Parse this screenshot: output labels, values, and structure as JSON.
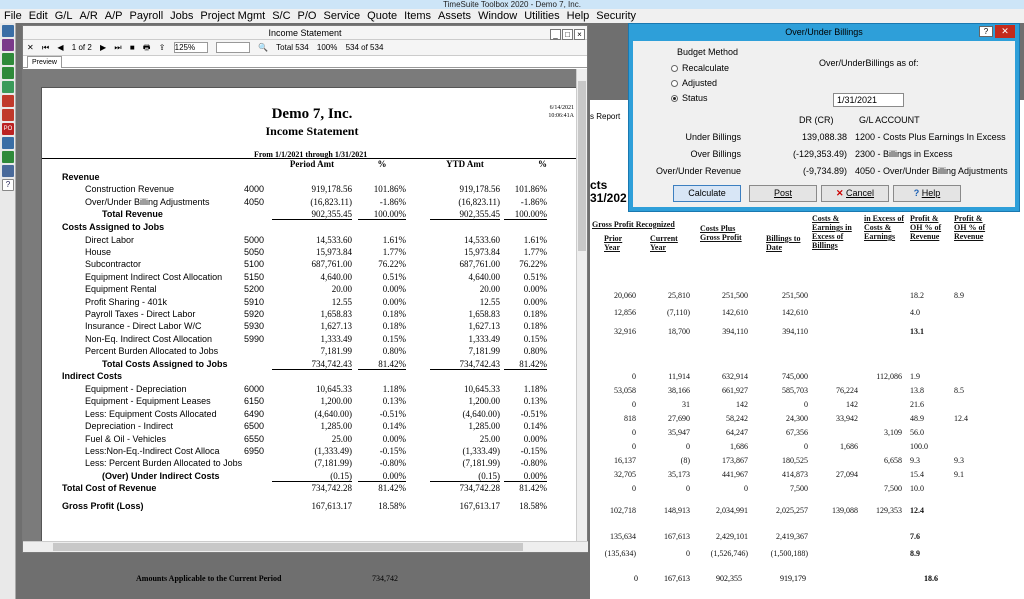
{
  "app": {
    "title": "TimeSuite Toolbox 2020 - Demo 7, Inc."
  },
  "menu": [
    "File",
    "Edit",
    "G/L",
    "A/R",
    "A/P",
    "Payroll",
    "Jobs",
    "Project Mgmt",
    "S/C",
    "P/O",
    "Service",
    "Quote",
    "Items",
    "Assets",
    "Window",
    "Utilities",
    "Help",
    "Security"
  ],
  "income_window": {
    "title": "Income Statement",
    "page": "1 of 2",
    "zoom": "125%",
    "total_label": "Total 534",
    "percent": "100%",
    "count": "534 of 534",
    "tab": "Preview"
  },
  "report": {
    "company": "Demo 7, Inc.",
    "title": "Income Statement",
    "date": "6/14/2021",
    "time": "10:06:41A",
    "range": "From 1/1/2021 through 1/31/2021",
    "headers": {
      "period_amt": "Period Amt",
      "period_pct": "%",
      "ytd_amt": "YTD Amt",
      "ytd_pct": "%"
    },
    "rows": [
      {
        "type": "sec",
        "label": "Revenue"
      },
      {
        "label": "Construction Revenue",
        "code": "4000",
        "pa": "919,178.56",
        "pp": "101.86%",
        "ya": "919,178.56",
        "yp": "101.86%"
      },
      {
        "label": "Over/Under Billing Adjustments",
        "code": "4050",
        "pa": "(16,823.11)",
        "pp": "-1.86%",
        "ya": "(16,823.11)",
        "yp": "-1.86%"
      },
      {
        "type": "tot",
        "label": "Total Revenue",
        "pa": "902,355.45",
        "pp": "100.00%",
        "ya": "902,355.45",
        "yp": "100.00%"
      },
      {
        "type": "sec",
        "label": "Costs Assigned to Jobs"
      },
      {
        "label": "Direct Labor",
        "code": "5000",
        "pa": "14,533.60",
        "pp": "1.61%",
        "ya": "14,533.60",
        "yp": "1.61%"
      },
      {
        "label": "House",
        "code": "5050",
        "pa": "15,973.84",
        "pp": "1.77%",
        "ya": "15,973.84",
        "yp": "1.77%"
      },
      {
        "label": "Subcontractor",
        "code": "5100",
        "pa": "687,761.00",
        "pp": "76.22%",
        "ya": "687,761.00",
        "yp": "76.22%"
      },
      {
        "label": "Equipment Indirect Cost Allocation",
        "code": "5150",
        "pa": "4,640.00",
        "pp": "0.51%",
        "ya": "4,640.00",
        "yp": "0.51%"
      },
      {
        "label": "Equipment Rental",
        "code": "5200",
        "pa": "20.00",
        "pp": "0.00%",
        "ya": "20.00",
        "yp": "0.00%"
      },
      {
        "label": "Profit Sharing - 401k",
        "code": "5910",
        "pa": "12.55",
        "pp": "0.00%",
        "ya": "12.55",
        "yp": "0.00%"
      },
      {
        "label": "Payroll Taxes - Direct Labor",
        "code": "5920",
        "pa": "1,658.83",
        "pp": "0.18%",
        "ya": "1,658.83",
        "yp": "0.18%"
      },
      {
        "label": "Insurance - Direct Labor W/C",
        "code": "5930",
        "pa": "1,627.13",
        "pp": "0.18%",
        "ya": "1,627.13",
        "yp": "0.18%"
      },
      {
        "label": "Non-Eq. Indirect Cost Allocation",
        "code": "5990",
        "pa": "1,333.49",
        "pp": "0.15%",
        "ya": "1,333.49",
        "yp": "0.15%"
      },
      {
        "label": "Percent Burden Allocated to Jobs",
        "code": "",
        "pa": "7,181.99",
        "pp": "0.80%",
        "ya": "7,181.99",
        "yp": "0.80%"
      },
      {
        "type": "tot",
        "label": "Total Costs Assigned to Jobs",
        "pa": "734,742.43",
        "pp": "81.42%",
        "ya": "734,742.43",
        "yp": "81.42%"
      },
      {
        "type": "sec",
        "label": "Indirect Costs"
      },
      {
        "label": "Equipment - Depreciation",
        "code": "6000",
        "pa": "10,645.33",
        "pp": "1.18%",
        "ya": "10,645.33",
        "yp": "1.18%"
      },
      {
        "label": "Equipment - Equipment Leases",
        "code": "6150",
        "pa": "1,200.00",
        "pp": "0.13%",
        "ya": "1,200.00",
        "yp": "0.13%"
      },
      {
        "label": "Less: Equipment Costs Allocated",
        "code": "6490",
        "pa": "(4,640.00)",
        "pp": "-0.51%",
        "ya": "(4,640.00)",
        "yp": "-0.51%"
      },
      {
        "label": "Depreciation - Indirect",
        "code": "6500",
        "pa": "1,285.00",
        "pp": "0.14%",
        "ya": "1,285.00",
        "yp": "0.14%"
      },
      {
        "label": "Fuel & Oil - Vehicles",
        "code": "6550",
        "pa": "25.00",
        "pp": "0.00%",
        "ya": "25.00",
        "yp": "0.00%"
      },
      {
        "label": "Less:Non-Eq.-Indirect Cost Alloca",
        "code": "6950",
        "pa": "(1,333.49)",
        "pp": "-0.15%",
        "ya": "(1,333.49)",
        "yp": "-0.15%"
      },
      {
        "label": "Less: Percent Burden Allocated to Jobs",
        "code": "",
        "pa": "(7,181.99)",
        "pp": "-0.80%",
        "ya": "(7,181.99)",
        "yp": "-0.80%"
      },
      {
        "type": "tot",
        "label": "(Over) Under Indirect Costs",
        "pa": "(0.15)",
        "pp": "0.00%",
        "ya": "(0.15)",
        "yp": "0.00%"
      },
      {
        "type": "sec",
        "label": "Total Cost of Revenue",
        "pa": "734,742.28",
        "pp": "81.42%",
        "ya": "734,742.28",
        "yp": "81.42%"
      },
      {
        "type": "sec",
        "label": "Gross Profit (Loss)",
        "pa": "167,613.17",
        "pp": "18.58%",
        "ya": "167,613.17",
        "yp": "18.58%"
      }
    ]
  },
  "dialog": {
    "title": "Over/Under Billings",
    "budget_method": "Budget Method",
    "options": [
      "Recalculate",
      "Adjusted",
      "Status"
    ],
    "as_of_label": "Over/UnderBillings as of:",
    "as_of_date": "1/31/2021",
    "col_dr": "DR (CR)",
    "col_gl": "G/L ACCOUNT",
    "lines": [
      {
        "label": "Under Billings",
        "amt": "139,088.38",
        "gl": "1200 - Costs Plus Earnings In Excess"
      },
      {
        "label": "Over Billings",
        "amt": "(-129,353.49)",
        "gl": "2300 - Billings in Excess"
      },
      {
        "label": "Over/Under Revenue",
        "amt": "(-9,734.89)",
        "gl": "4050 - Over/Under Billing Adjustments"
      }
    ],
    "buttons": {
      "calculate": "Calculate",
      "post": "Post",
      "cancel": "Cancel",
      "help": "Help"
    }
  },
  "background_report": {
    "fragments": [
      "s Report",
      "cts",
      "31/202"
    ],
    "head": [
      "Gross Profit Recognized",
      "Prior Year",
      "Current Year",
      "Costs Plus Gross Profit",
      "Billings to Date",
      "Costs & Earnings in Excess of Billings",
      "in Excess of Costs & Earnings",
      "Profit & OH % of Revenue",
      "Profit & OH % of Revenue"
    ],
    "rows": [
      [
        "20,060",
        "25,810",
        "251,500",
        "251,500",
        "",
        "",
        "18.2",
        "8.9"
      ],
      [
        "12,856",
        "(7,110)",
        "142,610",
        "142,610",
        "",
        "",
        "4.0",
        ""
      ],
      [
        "32,916",
        "18,700",
        "394,110",
        "394,110",
        "",
        "",
        "13.1",
        ""
      ],
      [
        "0",
        "11,914",
        "632,914",
        "745,000",
        "",
        "112,086",
        "1.9",
        ""
      ],
      [
        "53,058",
        "38,166",
        "661,927",
        "585,703",
        "76,224",
        "",
        "13.8",
        "8.5"
      ],
      [
        "0",
        "31",
        "142",
        "0",
        "142",
        "",
        "21.6",
        ""
      ],
      [
        "818",
        "27,690",
        "58,242",
        "24,300",
        "33,942",
        "",
        "48.9",
        "12.4"
      ],
      [
        "0",
        "35,947",
        "64,247",
        "67,356",
        "",
        "3,109",
        "56.0",
        ""
      ],
      [
        "0",
        "0",
        "1,686",
        "0",
        "1,686",
        "",
        "100.0",
        ""
      ],
      [
        "16,137",
        "(8)",
        "173,867",
        "180,525",
        "",
        "6,658",
        "9.3",
        "9.3"
      ],
      [
        "32,705",
        "35,173",
        "441,967",
        "414,873",
        "27,094",
        "",
        "15.4",
        "9.1"
      ],
      [
        "0",
        "0",
        "0",
        "7,500",
        "",
        "7,500",
        "10.0",
        ""
      ],
      [
        "102,718",
        "148,913",
        "2,034,991",
        "2,025,257",
        "139,088",
        "129,353",
        "12.4",
        ""
      ],
      [
        "135,634",
        "167,613",
        "2,429,101",
        "2,419,367",
        "",
        "",
        "7.6",
        ""
      ],
      [
        "(135,634)",
        "0",
        "(1,526,746)",
        "(1,500,188)",
        "",
        "",
        "8.9",
        ""
      ]
    ],
    "bottom": {
      "label": "Amounts Applicable to the Current Period",
      "v1": "734,742",
      "v2": "0",
      "v3": "167,613",
      "v4": "902,355",
      "v5": "919,179",
      "v6": "18.6"
    }
  }
}
